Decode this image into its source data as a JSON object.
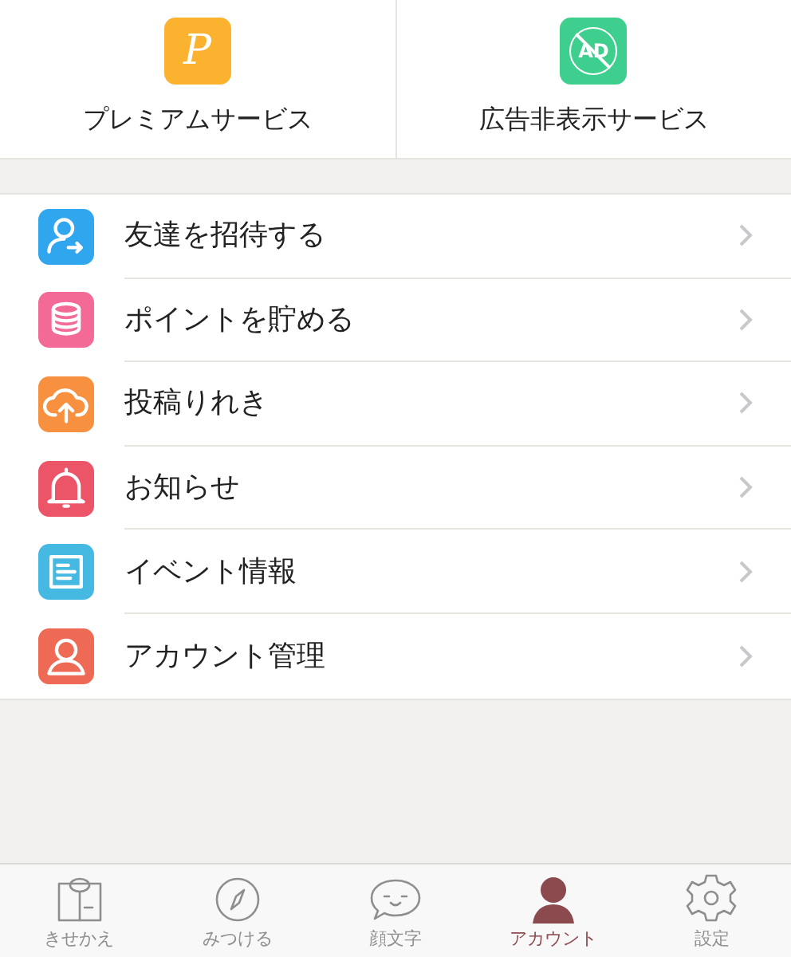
{
  "services": [
    {
      "label": "プレミアムサービス",
      "glyph": "P",
      "kind": "premium",
      "color": "#fbb22f"
    },
    {
      "label": "広告非表示サービス",
      "glyph": "AD",
      "kind": "noads",
      "color": "#3ecf8e"
    }
  ],
  "menu": [
    {
      "label": "友達を招待する",
      "kind": "invite",
      "color": "#2fa6ee"
    },
    {
      "label": "ポイントを貯める",
      "kind": "points",
      "color": "#f46a97"
    },
    {
      "label": "投稿りれき",
      "kind": "upload",
      "color": "#f7913f"
    },
    {
      "label": "お知らせ",
      "kind": "bell",
      "color": "#ec5568"
    },
    {
      "label": "イベント情報",
      "kind": "doc",
      "color": "#46b9e3"
    },
    {
      "label": "アカウント管理",
      "kind": "user",
      "color": "#ee6a55"
    }
  ],
  "tabs": [
    {
      "label": "きせかえ",
      "kind": "shirt",
      "selected": false
    },
    {
      "label": "みつける",
      "kind": "compass",
      "selected": false
    },
    {
      "label": "顔文字",
      "kind": "face",
      "selected": false
    },
    {
      "label": "アカウント",
      "kind": "person",
      "selected": true
    },
    {
      "label": "設定",
      "kind": "gear",
      "selected": false
    }
  ]
}
